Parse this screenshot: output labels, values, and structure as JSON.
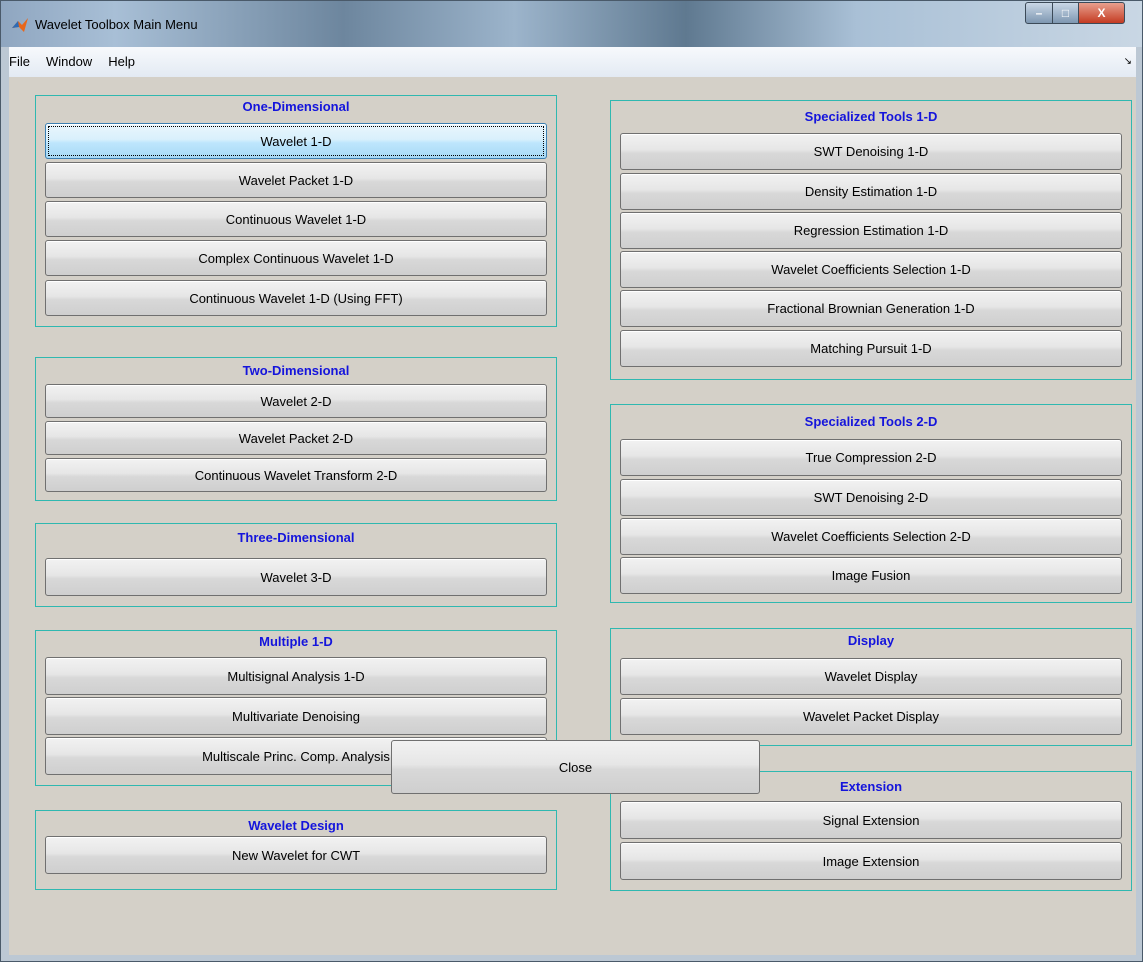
{
  "window": {
    "title": "Wavelet Toolbox Main Menu",
    "controls": {
      "minimize": "–",
      "maximize": "□",
      "close": "X"
    }
  },
  "menubar": {
    "items": [
      "File",
      "Window",
      "Help"
    ],
    "arrow": "↘"
  },
  "panels": {
    "one_dimensional": {
      "title": "One-Dimensional",
      "buttons": [
        "Wavelet 1-D",
        "Wavelet Packet 1-D",
        "Continuous Wavelet 1-D",
        "Complex Continuous Wavelet 1-D",
        "Continuous Wavelet 1-D (Using FFT)"
      ]
    },
    "two_dimensional": {
      "title": "Two-Dimensional",
      "buttons": [
        "Wavelet 2-D",
        "Wavelet Packet 2-D",
        "Continuous Wavelet Transform 2-D"
      ]
    },
    "three_dimensional": {
      "title": "Three-Dimensional",
      "buttons": [
        "Wavelet 3-D"
      ]
    },
    "multiple_1d": {
      "title": "Multiple 1-D",
      "buttons": [
        "Multisignal Analysis 1-D",
        "Multivariate Denoising",
        "Multiscale Princ. Comp. Analysis"
      ]
    },
    "wavelet_design": {
      "title": "Wavelet Design",
      "buttons": [
        "New Wavelet for CWT"
      ]
    },
    "specialized_1d": {
      "title": "Specialized Tools 1-D",
      "buttons": [
        "SWT Denoising 1-D",
        "Density Estimation 1-D",
        "Regression Estimation 1-D",
        "Wavelet Coefficients Selection 1-D",
        "Fractional Brownian Generation 1-D",
        "Matching Pursuit 1-D"
      ]
    },
    "specialized_2d": {
      "title": "Specialized Tools 2-D",
      "buttons": [
        "True Compression 2-D",
        "SWT Denoising 2-D",
        "Wavelet Coefficients Selection 2-D",
        "Image Fusion"
      ]
    },
    "display": {
      "title": "Display",
      "buttons": [
        "Wavelet Display",
        "Wavelet Packet Display"
      ]
    },
    "extension": {
      "title": "Extension",
      "buttons": [
        "Signal Extension",
        "Image Extension"
      ]
    }
  },
  "close_button": {
    "label": "Close"
  },
  "colors": {
    "panel_border": "#2fb8b0",
    "panel_title": "#1414dc",
    "active_button": "#bee6fd"
  }
}
